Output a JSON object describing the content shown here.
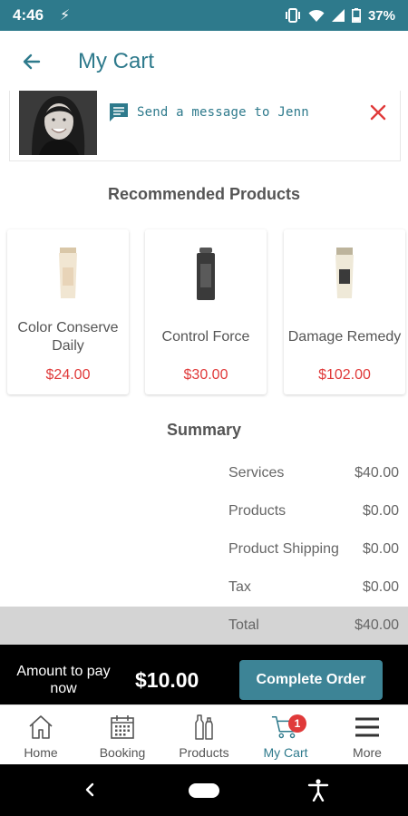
{
  "status_bar": {
    "time": "4:46",
    "battery": "37%"
  },
  "header": {
    "title": "My Cart"
  },
  "stylist": {
    "message_label": "Send a message to Jenn"
  },
  "recommended": {
    "title": "Recommended Products",
    "products": [
      {
        "name": "Color Conserve Daily",
        "price": "$24.00"
      },
      {
        "name": "Control Force",
        "price": "$30.00"
      },
      {
        "name": "Damage Remedy",
        "price": "$102.00"
      }
    ]
  },
  "summary": {
    "title": "Summary",
    "rows": [
      {
        "label": "Services",
        "value": "$40.00"
      },
      {
        "label": "Products",
        "value": "$0.00"
      },
      {
        "label": "Product Shipping",
        "value": "$0.00"
      },
      {
        "label": "Tax",
        "value": "$0.00"
      },
      {
        "label": "Total",
        "value": "$40.00"
      }
    ]
  },
  "pay_bar": {
    "amount_label": "Amount to pay now",
    "amount": "$10.00",
    "complete_label": "Complete Order"
  },
  "bottom_nav": {
    "items": [
      {
        "label": "Home",
        "icon": "home-icon"
      },
      {
        "label": "Booking",
        "icon": "calendar-icon"
      },
      {
        "label": "Products",
        "icon": "bottles-icon"
      },
      {
        "label": "My Cart",
        "icon": "cart-icon",
        "badge": "1"
      },
      {
        "label": "More",
        "icon": "menu-icon"
      }
    ]
  },
  "colors": {
    "brand": "#2e7a8c",
    "price": "#e03a3a",
    "button": "#3d8496",
    "badge": "#e03a3a"
  }
}
